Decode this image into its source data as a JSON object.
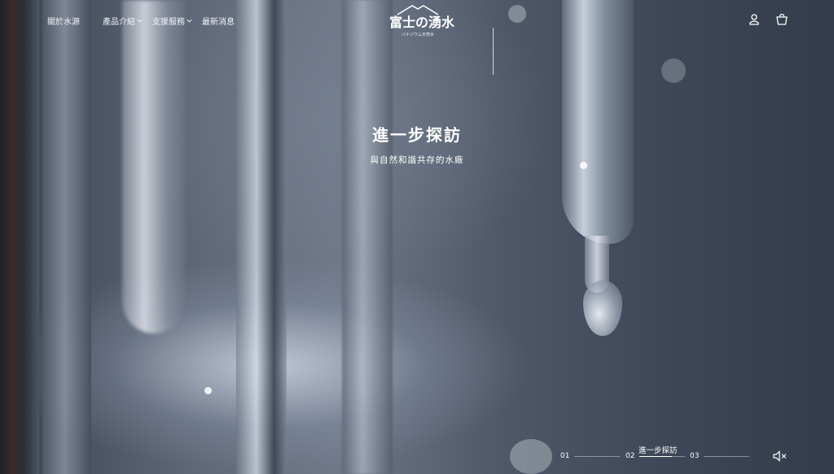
{
  "nav": {
    "items": [
      {
        "label": "關於水源",
        "has_dropdown": false
      },
      {
        "label": "產品介紹",
        "has_dropdown": true
      },
      {
        "label": "支援服務",
        "has_dropdown": true
      },
      {
        "label": "最新消息",
        "has_dropdown": false
      }
    ]
  },
  "logo": {
    "mark": "富士の湧水",
    "sub": "バナジウム天然水"
  },
  "header_icons": [
    "user-icon",
    "cart-icon"
  ],
  "hero": {
    "headline": "進一步探訪",
    "subline": "與自然和諧共存的水廠"
  },
  "slider": {
    "slides": [
      {
        "number": "01"
      },
      {
        "number": "02"
      },
      {
        "number": "03"
      }
    ],
    "active_index": 1,
    "active_caption": "進一步探訪"
  },
  "controls": {
    "mute_icon": "speaker-muted-icon"
  }
}
